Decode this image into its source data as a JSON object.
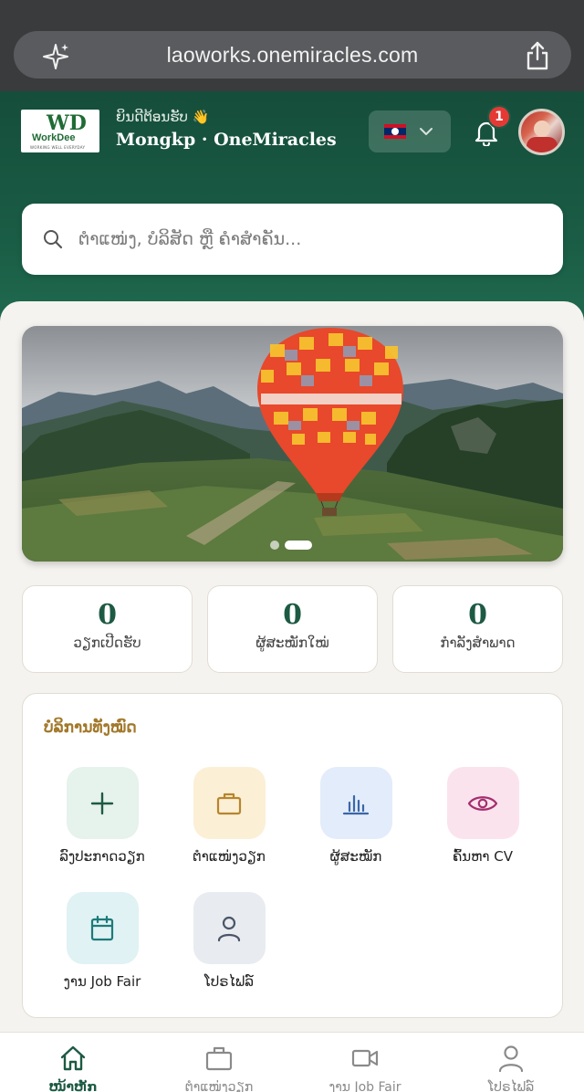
{
  "browser": {
    "url": "laoworks.onemiracles.com"
  },
  "header": {
    "logo_text": "WorkDee",
    "logo_letters": "WD",
    "logo_tagline": "WORKING WELL EVERYDAY",
    "welcome": "ຍິນດີຕ້ອນຮັບ 👋",
    "username": "Mongkp · OneMiracles",
    "language_flag": "lao-flag-icon",
    "notification_count": "1"
  },
  "search": {
    "placeholder": "ຕຳແໜ່ງ, ບໍລິສັດ ຫຼື ຄຳສຳຄັນ..."
  },
  "banner": {
    "slide_count": 2,
    "active_slide": 2
  },
  "stats": [
    {
      "value": "0",
      "label": "ວຽກເປີດຮັບ"
    },
    {
      "value": "0",
      "label": "ຜູ້ສະໝັກໃໝ່"
    },
    {
      "value": "0",
      "label": "ກຳລັງສຳພາດ"
    }
  ],
  "services": {
    "title": "ບໍລິການທັງໝົດ",
    "items": [
      {
        "label": "ລົງປະກາດວຽກ",
        "icon": "plus-icon",
        "color": "#e6f2ec"
      },
      {
        "label": "ຕຳແໜ່ງວຽກ",
        "icon": "briefcase-icon",
        "color": "#fbefd6"
      },
      {
        "label": "ຜູ້ສະໝັກ",
        "icon": "bar-chart-icon",
        "color": "#e3ecfa"
      },
      {
        "label": "ຄົ້ນຫາ CV",
        "icon": "eye-icon",
        "color": "#fbe3ee"
      },
      {
        "label": "ງານ Job Fair",
        "icon": "calendar-icon",
        "color": "#e0f2f3"
      },
      {
        "label": "ໂປຣໄຟລ໌",
        "icon": "user-icon",
        "color": "#e8ebef"
      }
    ]
  },
  "bottom_nav": [
    {
      "label": "ໜ້າຫຼັກ",
      "icon": "home-icon",
      "active": true
    },
    {
      "label": "ຕຳແໜ່ງວຽກ",
      "icon": "briefcase-icon",
      "active": false
    },
    {
      "label": "ງານ Job Fair",
      "icon": "video-icon",
      "active": false
    },
    {
      "label": "ໂປຣໄຟລ໌",
      "icon": "user-icon",
      "active": false
    }
  ],
  "colors": {
    "brand_green": "#1a5c45",
    "accent_gold": "#a2782a",
    "badge_red": "#e53935"
  }
}
